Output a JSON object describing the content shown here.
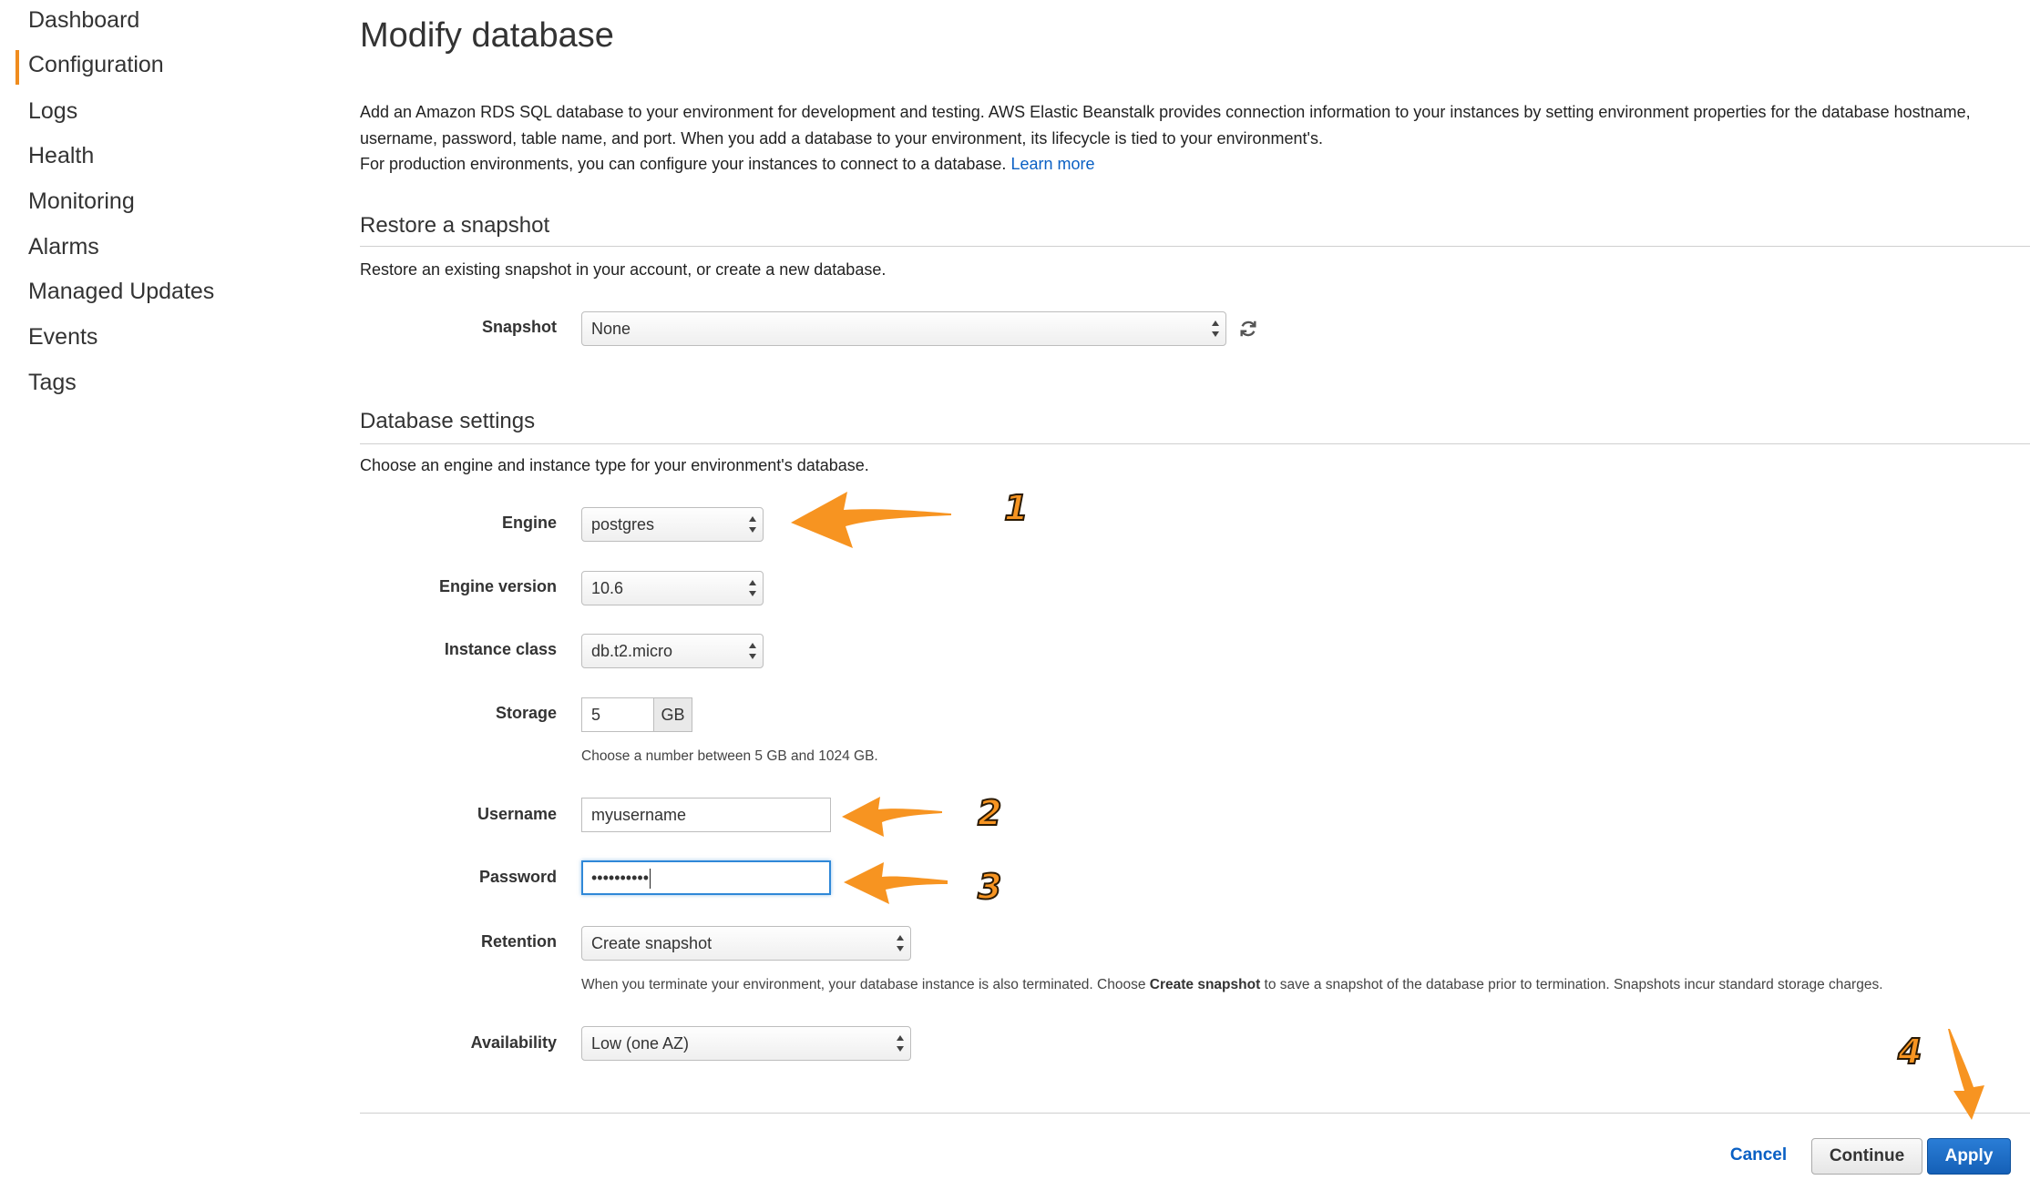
{
  "sidebar": {
    "items": [
      {
        "label": "Dashboard"
      },
      {
        "label": "Configuration",
        "active": true
      },
      {
        "label": "Logs"
      },
      {
        "label": "Health"
      },
      {
        "label": "Monitoring"
      },
      {
        "label": "Alarms"
      },
      {
        "label": "Managed Updates"
      },
      {
        "label": "Events"
      },
      {
        "label": "Tags"
      }
    ]
  },
  "page": {
    "title": "Modify database",
    "intro_1": "Add an Amazon RDS SQL database to your environment for development and testing. AWS Elastic Beanstalk provides connection information to your instances by setting environment properties for the database hostname, username, password, table name, and port. When you add a database to your environment, its lifecycle is tied to your environment's.",
    "intro_2": "For production environments, you can configure your instances to connect to a database.",
    "learn_more": "Learn more"
  },
  "snapshot_section": {
    "title": "Restore a snapshot",
    "description": "Restore an existing snapshot in your account, or create a new database.",
    "snapshot_label": "Snapshot",
    "snapshot_value": "None"
  },
  "db_section": {
    "title": "Database settings",
    "description": "Choose an engine and instance type for your environment's database.",
    "engine_label": "Engine",
    "engine_value": "postgres",
    "engine_version_label": "Engine version",
    "engine_version_value": "10.6",
    "instance_class_label": "Instance class",
    "instance_class_value": "db.t2.micro",
    "storage_label": "Storage",
    "storage_value": "5",
    "storage_unit": "GB",
    "storage_hint": "Choose a number between 5 GB and 1024 GB.",
    "username_label": "Username",
    "username_value": "myusername",
    "password_label": "Password",
    "password_value": "••••••••••",
    "retention_label": "Retention",
    "retention_value": "Create snapshot",
    "retention_hint_pre": "When you terminate your environment, your database instance is also terminated. Choose ",
    "retention_hint_bold": "Create snapshot",
    "retention_hint_post": " to save a snapshot of the database prior to termination. Snapshots incur standard storage charges.",
    "availability_label": "Availability",
    "availability_value": "Low (one AZ)"
  },
  "footer": {
    "cancel_label": "Cancel",
    "continue_label": "Continue",
    "apply_label": "Apply"
  },
  "annotations": {
    "step_1": "1",
    "step_2": "2",
    "step_3": "3",
    "step_4": "4",
    "arrow_color": "#f79421"
  }
}
